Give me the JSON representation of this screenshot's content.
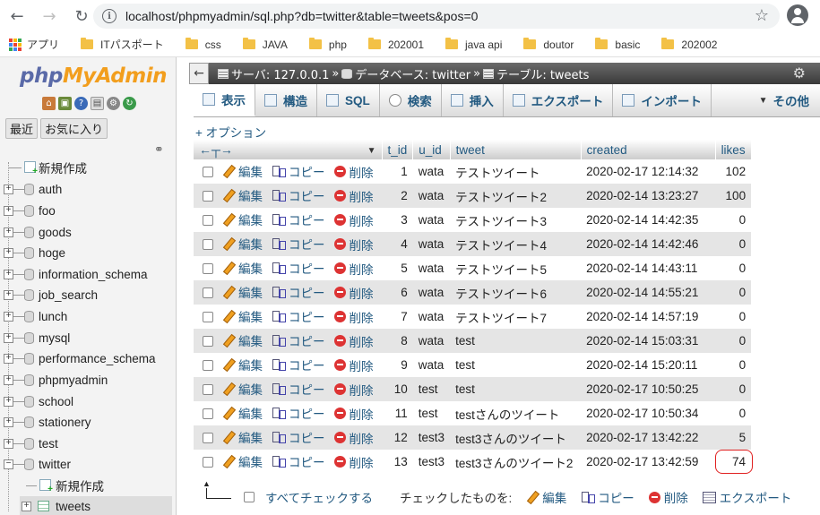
{
  "browser": {
    "url": "localhost/phpmyadmin/sql.php?db=twitter&table=tweets&pos=0",
    "bookmarks": [
      "アプリ",
      "ITパスポート",
      "css",
      "JAVA",
      "php",
      "202001",
      "java api",
      "doutor",
      "basic",
      "202002"
    ]
  },
  "leftnav": {
    "logo_php": "php",
    "logo_myadmin": "MyAdmin",
    "tabs": [
      "最近",
      "お気に入り"
    ],
    "new_label": "新規作成",
    "databases": [
      "auth",
      "foo",
      "goods",
      "hoge",
      "information_schema",
      "job_search",
      "lunch",
      "mysql",
      "performance_schema",
      "phpmyadmin",
      "school",
      "stationery",
      "test",
      "twitter"
    ],
    "twitter_children": [
      "新規作成",
      "tweets"
    ]
  },
  "breadcrumb": {
    "server": "サーバ: 127.0.0.1",
    "database": "データベース: twitter",
    "table": "テーブル: tweets",
    "sep": "»"
  },
  "tabs": [
    "表示",
    "構造",
    "SQL",
    "検索",
    "挿入",
    "エクスポート",
    "インポート",
    "その他"
  ],
  "options_label": "+ オプション",
  "table": {
    "columns": [
      "t_id",
      "u_id",
      "tweet",
      "created",
      "likes"
    ],
    "actions": {
      "edit": "編集",
      "copy": "コピー",
      "delete": "削除"
    },
    "rows": [
      {
        "t_id": "1",
        "u_id": "wata",
        "tweet": "テストツイート",
        "created": "2020-02-17 12:14:32",
        "likes": "102"
      },
      {
        "t_id": "2",
        "u_id": "wata",
        "tweet": "テストツイート2",
        "created": "2020-02-14 13:23:27",
        "likes": "100"
      },
      {
        "t_id": "3",
        "u_id": "wata",
        "tweet": "テストツイート3",
        "created": "2020-02-14 14:42:35",
        "likes": "0"
      },
      {
        "t_id": "4",
        "u_id": "wata",
        "tweet": "テストツイート4",
        "created": "2020-02-14 14:42:46",
        "likes": "0"
      },
      {
        "t_id": "5",
        "u_id": "wata",
        "tweet": "テストツイート5",
        "created": "2020-02-14 14:43:11",
        "likes": "0"
      },
      {
        "t_id": "6",
        "u_id": "wata",
        "tweet": "テストツイート6",
        "created": "2020-02-14 14:55:21",
        "likes": "0"
      },
      {
        "t_id": "7",
        "u_id": "wata",
        "tweet": "テストツイート7",
        "created": "2020-02-14 14:57:19",
        "likes": "0"
      },
      {
        "t_id": "8",
        "u_id": "wata",
        "tweet": "test",
        "created": "2020-02-14 15:03:31",
        "likes": "0"
      },
      {
        "t_id": "9",
        "u_id": "wata",
        "tweet": "test",
        "created": "2020-02-14 15:20:11",
        "likes": "0"
      },
      {
        "t_id": "10",
        "u_id": "test",
        "tweet": "test",
        "created": "2020-02-17 10:50:25",
        "likes": "0"
      },
      {
        "t_id": "11",
        "u_id": "test",
        "tweet": "testさんのツイート",
        "created": "2020-02-17 10:50:34",
        "likes": "0"
      },
      {
        "t_id": "12",
        "u_id": "test3",
        "tweet": "test3さんのツイート",
        "created": "2020-02-17 13:42:22",
        "likes": "5"
      },
      {
        "t_id": "13",
        "u_id": "test3",
        "tweet": "test3さんのツイート2",
        "created": "2020-02-17 13:42:59",
        "likes": "74"
      }
    ]
  },
  "bottom": {
    "check_all": "すべてチェックする",
    "with_selected": "チェックしたものを:",
    "edit": "編集",
    "copy": "コピー",
    "delete": "削除",
    "export": "エクスポート"
  }
}
